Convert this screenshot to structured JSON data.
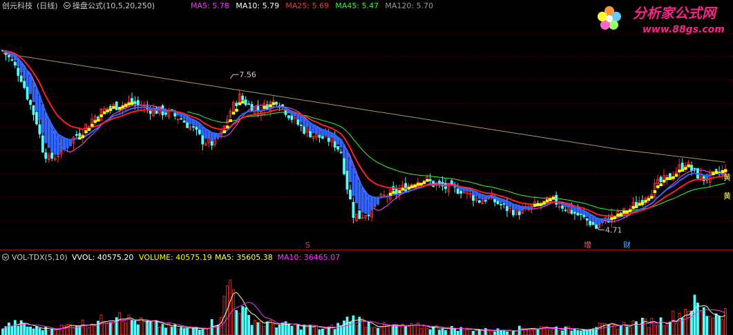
{
  "header": {
    "stock_name": "创元科技",
    "period": "(日线)",
    "formula_icon": "circle-dropdown-icon",
    "formula": "操盘公式(10,5,20,250)",
    "ma_items": [
      {
        "label": "MA5: 5.78",
        "color": "#ff33ff"
      },
      {
        "label": "MA10: 5.79",
        "color": "#ffffff"
      },
      {
        "label": "MA25: 5.69",
        "color": "#ff3333"
      },
      {
        "label": "MA45: 5.47",
        "color": "#33ff33"
      },
      {
        "label": "MA120: 5.70",
        "color": "#999999"
      }
    ]
  },
  "watermark": {
    "brand": "分析家公式网",
    "url": "www.88gs.com",
    "icon": "flower-logo-icon"
  },
  "price_panel": {
    "high_marker": "7.56",
    "low_marker": "4.71",
    "signal_s": "S",
    "signal_zeng": "增",
    "signal_cai": "财",
    "right_tag_1": "黄",
    "right_tag_2": "黄"
  },
  "volume_panel": {
    "icon": "circle-dropdown-icon",
    "indicator": "VOL-TDX(5,10)",
    "items": [
      {
        "label": "VVOL: 40575.20",
        "color": "#ffffff"
      },
      {
        "label": "VOLUME: 40575.19",
        "color": "#ffff00"
      },
      {
        "label": "MA5: 35605.38",
        "color": "#ffff66"
      },
      {
        "label": "MA10: 36465.07",
        "color": "#ff33ff"
      }
    ]
  },
  "colors": {
    "up": "#ff3333",
    "down": "#55ffff",
    "blue_line": "#3366ff",
    "red_line": "#ff2222",
    "slow_line": "#aa9966",
    "green_line": "#33ff33",
    "yellow_step": "#ffff00",
    "grid": "#800000"
  },
  "chart_data": [
    {
      "type": "candlestick",
      "title": "创元科技 (日线) 操盘公式(10,5,20,250)",
      "xlabel": "",
      "ylabel": "",
      "grid": "dotted horizontal",
      "marked_high": 7.56,
      "marked_low": 4.71,
      "last_values": {
        "MA5": 5.78,
        "MA10": 5.79,
        "MA25": 5.69,
        "MA45": 5.47,
        "MA120": 5.7
      },
      "ylim": [
        4.5,
        8.7
      ],
      "close_anchors": [
        [
          0,
          8.0
        ],
        [
          3,
          7.8
        ],
        [
          6,
          7.5
        ],
        [
          9,
          7.0
        ],
        [
          11,
          6.7
        ],
        [
          13,
          6.2
        ],
        [
          15,
          6.0
        ],
        [
          18,
          6.1
        ],
        [
          22,
          6.35
        ],
        [
          26,
          6.55
        ],
        [
          30,
          6.8
        ],
        [
          34,
          6.95
        ],
        [
          38,
          7.0
        ],
        [
          42,
          7.05
        ],
        [
          46,
          6.95
        ],
        [
          50,
          6.9
        ],
        [
          54,
          6.85
        ],
        [
          58,
          6.75
        ],
        [
          62,
          6.55
        ],
        [
          65,
          6.35
        ],
        [
          68,
          6.3
        ],
        [
          71,
          6.45
        ],
        [
          74,
          6.9
        ],
        [
          77,
          7.15
        ],
        [
          80,
          7.0
        ],
        [
          83,
          6.9
        ],
        [
          86,
          7.0
        ],
        [
          89,
          7.1
        ],
        [
          92,
          6.9
        ],
        [
          95,
          6.7
        ],
        [
          98,
          6.55
        ],
        [
          101,
          6.45
        ],
        [
          104,
          6.4
        ],
        [
          107,
          6.35
        ],
        [
          110,
          6.15
        ],
        [
          112,
          5.5
        ],
        [
          114,
          5.0
        ],
        [
          116,
          4.95
        ],
        [
          119,
          5.05
        ],
        [
          122,
          5.25
        ],
        [
          125,
          5.35
        ],
        [
          128,
          5.4
        ],
        [
          131,
          5.5
        ],
        [
          134,
          5.6
        ],
        [
          137,
          5.65
        ],
        [
          140,
          5.55
        ],
        [
          143,
          5.5
        ],
        [
          146,
          5.45
        ],
        [
          149,
          5.45
        ],
        [
          152,
          5.35
        ],
        [
          155,
          5.25
        ],
        [
          158,
          5.3
        ],
        [
          161,
          5.2
        ],
        [
          164,
          5.1
        ],
        [
          167,
          5.05
        ],
        [
          170,
          5.05
        ],
        [
          173,
          5.15
        ],
        [
          176,
          5.2
        ],
        [
          179,
          5.25
        ],
        [
          182,
          5.15
        ],
        [
          185,
          5.05
        ],
        [
          188,
          4.95
        ],
        [
          191,
          4.85
        ],
        [
          193,
          4.75
        ],
        [
          195,
          4.85
        ],
        [
          198,
          4.95
        ],
        [
          201,
          5.0
        ],
        [
          204,
          5.1
        ],
        [
          207,
          5.25
        ],
        [
          210,
          5.4
        ],
        [
          213,
          5.55
        ],
        [
          216,
          5.65
        ],
        [
          219,
          5.8
        ],
        [
          222,
          5.95
        ],
        [
          225,
          5.75
        ],
        [
          228,
          5.65
        ],
        [
          231,
          5.7
        ],
        [
          234,
          5.78
        ]
      ],
      "ma_lines": [
        {
          "name": "MA5",
          "color": "#ff33ff",
          "period": 5
        },
        {
          "name": "MA10",
          "color": "#ffffff",
          "period": 10
        },
        {
          "name": "MA25",
          "color": "#ff3333",
          "period": 25
        },
        {
          "name": "MA45",
          "color": "#33ff33",
          "period": 45
        },
        {
          "name": "MA120",
          "color": "#999999",
          "period": 120
        }
      ]
    },
    {
      "type": "bar",
      "title": "VOL-TDX(5,10)",
      "xlabel": "",
      "ylabel": "",
      "last_values": {
        "VVOL": 40575.2,
        "VOLUME": 40575.19,
        "MA5": 35605.38,
        "MA10": 36465.07
      },
      "ylim": [
        0,
        120000
      ],
      "volume_anchors": [
        [
          0,
          15000
        ],
        [
          5,
          20000
        ],
        [
          10,
          12000
        ],
        [
          15,
          10000
        ],
        [
          20,
          15000
        ],
        [
          25,
          20000
        ],
        [
          30,
          22000
        ],
        [
          35,
          30000
        ],
        [
          38,
          45000
        ],
        [
          40,
          28000
        ],
        [
          45,
          22000
        ],
        [
          50,
          18000
        ],
        [
          55,
          14000
        ],
        [
          60,
          10000
        ],
        [
          65,
          14000
        ],
        [
          70,
          25000
        ],
        [
          72,
          55000
        ],
        [
          74,
          95000
        ],
        [
          76,
          60000
        ],
        [
          78,
          40000
        ],
        [
          80,
          30000
        ],
        [
          85,
          20000
        ],
        [
          90,
          18000
        ],
        [
          95,
          15000
        ],
        [
          100,
          14000
        ],
        [
          105,
          10000
        ],
        [
          110,
          18000
        ],
        [
          113,
          30000
        ],
        [
          116,
          25000
        ],
        [
          120,
          18000
        ],
        [
          125,
          15000
        ],
        [
          130,
          14000
        ],
        [
          135,
          15000
        ],
        [
          140,
          13000
        ],
        [
          145,
          12000
        ],
        [
          150,
          10000
        ],
        [
          155,
          9000
        ],
        [
          160,
          8000
        ],
        [
          165,
          10000
        ],
        [
          170,
          12000
        ],
        [
          175,
          13000
        ],
        [
          180,
          12000
        ],
        [
          185,
          10000
        ],
        [
          190,
          12000
        ],
        [
          193,
          16000
        ],
        [
          196,
          14000
        ],
        [
          200,
          16000
        ],
        [
          205,
          20000
        ],
        [
          210,
          22000
        ],
        [
          215,
          25000
        ],
        [
          220,
          35000
        ],
        [
          224,
          55000
        ],
        [
          228,
          40000
        ],
        [
          231,
          35000
        ],
        [
          234,
          40575
        ]
      ]
    }
  ]
}
